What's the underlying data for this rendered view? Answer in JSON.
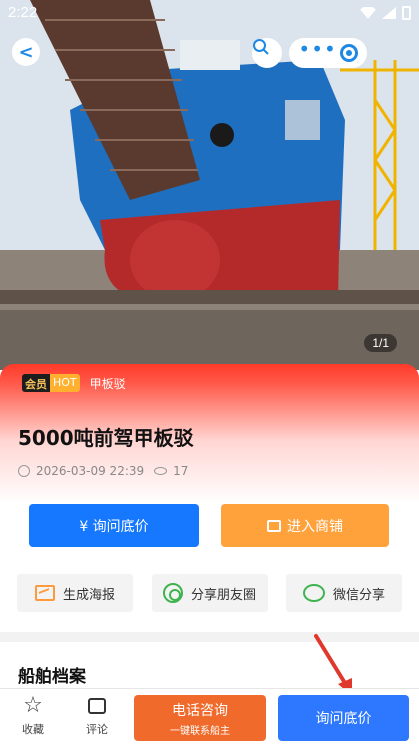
{
  "status_bar": {
    "time": "2:22"
  },
  "header": {
    "back_glyph": "<"
  },
  "gallery": {
    "counter": "1/1"
  },
  "listing": {
    "tag_vip": "会员",
    "tag_hot": "HOT",
    "category": "甲板驳",
    "title": "5000吨前驾甲板驳",
    "date": "2026-03-09 22:39",
    "views": "17"
  },
  "actions": {
    "ask_price": "¥ 询问底价",
    "enter_shop": "进入商铺"
  },
  "share": {
    "poster": "生成海报",
    "moments": "分享朋友圈",
    "wechat": "微信分享"
  },
  "section": {
    "title": "船舶档案"
  },
  "bottom_bar": {
    "collect": "收藏",
    "comment": "评论",
    "call_main": "电话咨询",
    "call_sub": "一键联系船主",
    "ask_price": "询问底价"
  },
  "colors": {
    "primary_blue": "#1677ff",
    "shop_orange": "#ffa23b",
    "call_orange": "#ef6a2b",
    "tag_red": "#ff3a2a"
  }
}
